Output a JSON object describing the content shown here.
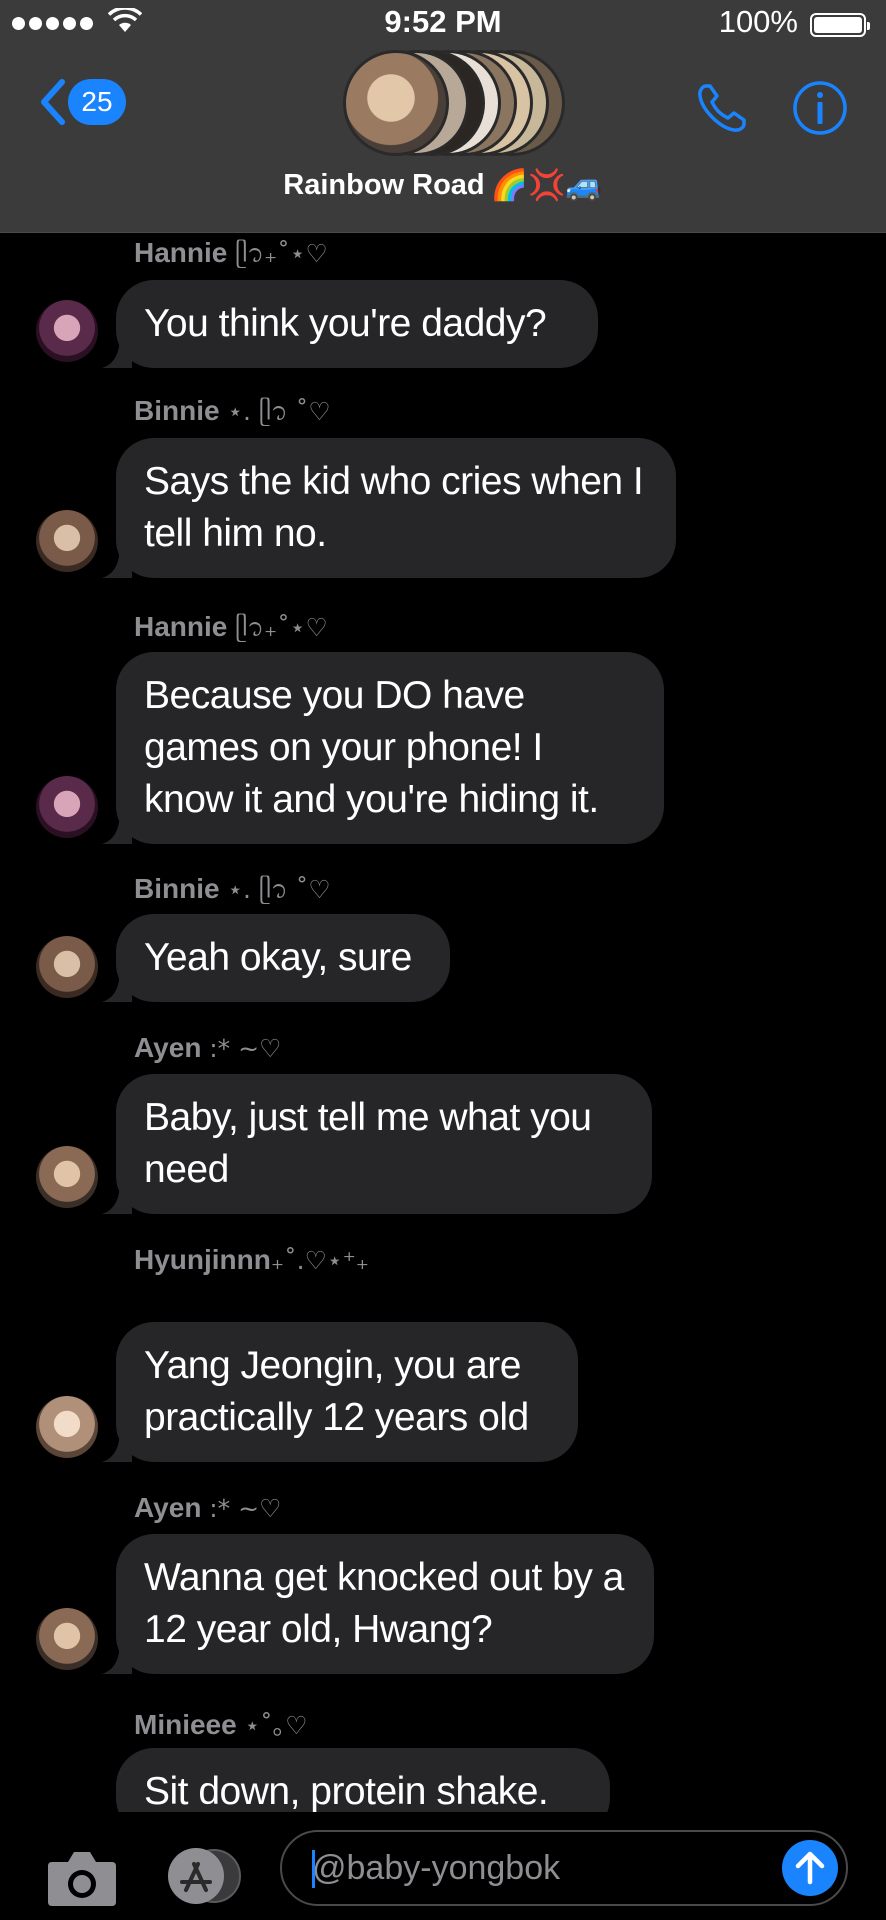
{
  "status": {
    "time": "9:52 PM",
    "battery": "100%"
  },
  "header": {
    "back_count": "25",
    "group_name": "Rainbow Road",
    "group_emoji": "🌈💢🚙"
  },
  "messages": [
    {
      "sender": "Hannie",
      "deco": "ᥫ᭡₊˚⋆♡",
      "text": "You think you're daddy?"
    },
    {
      "sender": "Binnie",
      "deco": "⋆. ᥫ᭡ ˚♡",
      "text": "Says the kid who cries when I tell him no."
    },
    {
      "sender": "Hannie",
      "deco": "ᥫ᭡₊˚⋆♡",
      "text": "Because you DO have games on your phone! I know it and you're hiding it."
    },
    {
      "sender": "Binnie",
      "deco": "⋆. ᥫ᭡ ˚♡",
      "text": "Yeah okay, sure"
    },
    {
      "sender": "Ayen",
      "deco": ":* ~♡",
      "text": "Baby, just tell me what you need"
    },
    {
      "sender": "Hyunjinnn",
      "deco": "₊˚.♡⋆⁺₊",
      "text": "Yang Jeongin, you are practically 12 years old"
    },
    {
      "sender": "Ayen",
      "deco": ":* ~♡",
      "text": "Wanna get knocked out by a 12 year old, Hwang?"
    },
    {
      "sender": "Minieee",
      "deco": "⋆˚｡♡",
      "text": "Sit down, protein shake."
    }
  ],
  "composer": {
    "value": "@baby-yongbok"
  },
  "icons": {
    "back": "chevron-left-icon",
    "phone": "phone-icon",
    "info": "info-icon",
    "camera": "camera-icon",
    "apps": "app-store-icon",
    "send": "arrow-up-icon"
  },
  "colors": {
    "accent": "#1a84ff",
    "bubble": "#262628",
    "header": "#3b3b3c",
    "sender": "#8e8e93"
  }
}
